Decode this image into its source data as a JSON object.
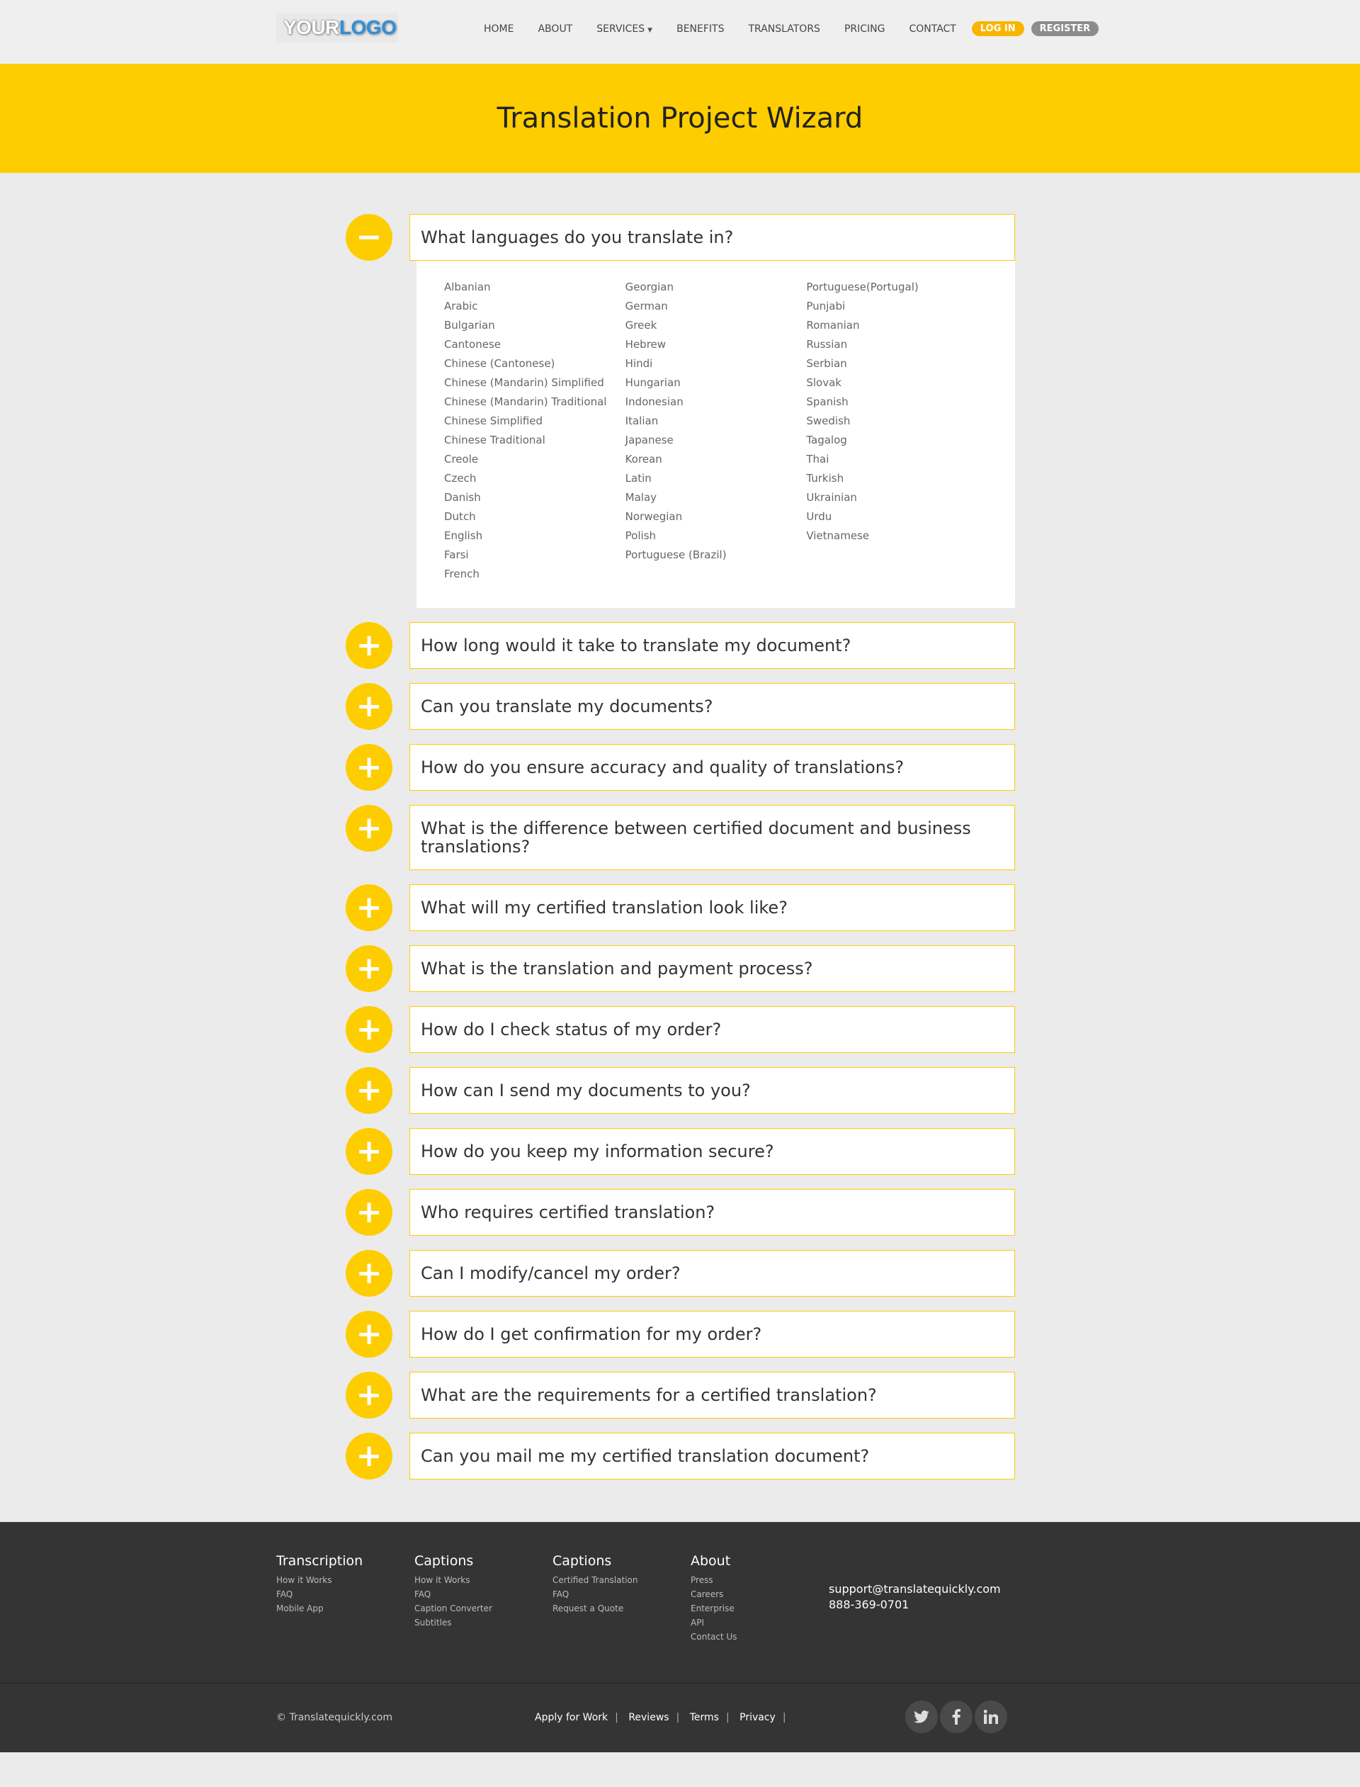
{
  "header": {
    "logo_your": "YOUR",
    "logo_logo": "LOGO",
    "nav": [
      "HOME",
      "ABOUT",
      "SERVICES",
      "BENEFITS",
      "TRANSLATORS",
      "PRICING",
      "CONTACT"
    ],
    "login": "LOG IN",
    "register": "REGISTER"
  },
  "banner": {
    "title": "Translation Project Wizard"
  },
  "faq": [
    {
      "q": "What languages do you translate in?",
      "expanded": true
    },
    {
      "q": "How long would it take to translate my document?"
    },
    {
      "q": "Can you translate my documents?"
    },
    {
      "q": "How do you ensure accuracy and quality of translations?"
    },
    {
      "q": "What is the difference between certified document and business translations?"
    },
    {
      "q": "What will my certified translation look like?"
    },
    {
      "q": "What is the translation and payment process?"
    },
    {
      "q": "How do I check status of my order?"
    },
    {
      "q": "How can I send my documents to you?"
    },
    {
      "q": "How do you keep my information secure?"
    },
    {
      "q": "Who requires certified translation?"
    },
    {
      "q": "Can I modify/cancel my order?"
    },
    {
      "q": "How do I get confirmation for my order?"
    },
    {
      "q": "What are the requirements for a certified translation?"
    },
    {
      "q": "Can you mail me my certified translation document?"
    }
  ],
  "languages": [
    [
      "Albanian",
      "Arabic",
      "Bulgarian",
      "Cantonese",
      "Chinese (Cantonese)",
      "Chinese (Mandarin) Simplified",
      "Chinese (Mandarin) Traditional",
      "Chinese Simplified",
      "Chinese Traditional",
      "Creole",
      "Czech",
      "Danish",
      "Dutch",
      "English",
      "Farsi",
      "French"
    ],
    [
      "Georgian",
      "German",
      "Greek",
      "Hebrew",
      "Hindi",
      "Hungarian",
      "Indonesian",
      "Italian",
      "Japanese",
      "Korean",
      "Latin",
      "Malay",
      "Norwegian",
      "Polish",
      "Portuguese (Brazil)"
    ],
    [
      "Portuguese(Portugal)",
      "Punjabi",
      "Romanian",
      "Russian",
      "Serbian",
      "Slovak",
      "Spanish",
      "Swedish",
      "Tagalog",
      "Thai",
      "Turkish",
      "Ukrainian",
      "Urdu",
      "Vietnamese"
    ]
  ],
  "icons": {
    "expanded": "minus-icon",
    "collapsed": "plus-icon"
  },
  "colors": {
    "accent": "#fecd00",
    "footer": "#343434"
  },
  "footer": {
    "columns": [
      {
        "title": "Transcription",
        "links": [
          "How it Works",
          "FAQ",
          "Mobile App"
        ]
      },
      {
        "title": "Captions",
        "links": [
          "How it Works",
          "FAQ",
          "Caption Converter",
          "Subtitles"
        ]
      },
      {
        "title": "Captions",
        "links": [
          "Certified Translation",
          "FAQ",
          "Request a Quote"
        ]
      },
      {
        "title": "About",
        "links": [
          "Press",
          "Careers",
          "Enterprise",
          "API",
          "Contact Us"
        ]
      }
    ],
    "email": "support@translatequickly.com",
    "phone": "888-369-0701",
    "copyright": "© Translatequickly.com",
    "bottom_links": [
      "Apply for Work",
      "Reviews",
      "Terms",
      "Privacy"
    ],
    "social": [
      "twitter-icon",
      "facebook-icon",
      "linkedin-icon"
    ]
  }
}
